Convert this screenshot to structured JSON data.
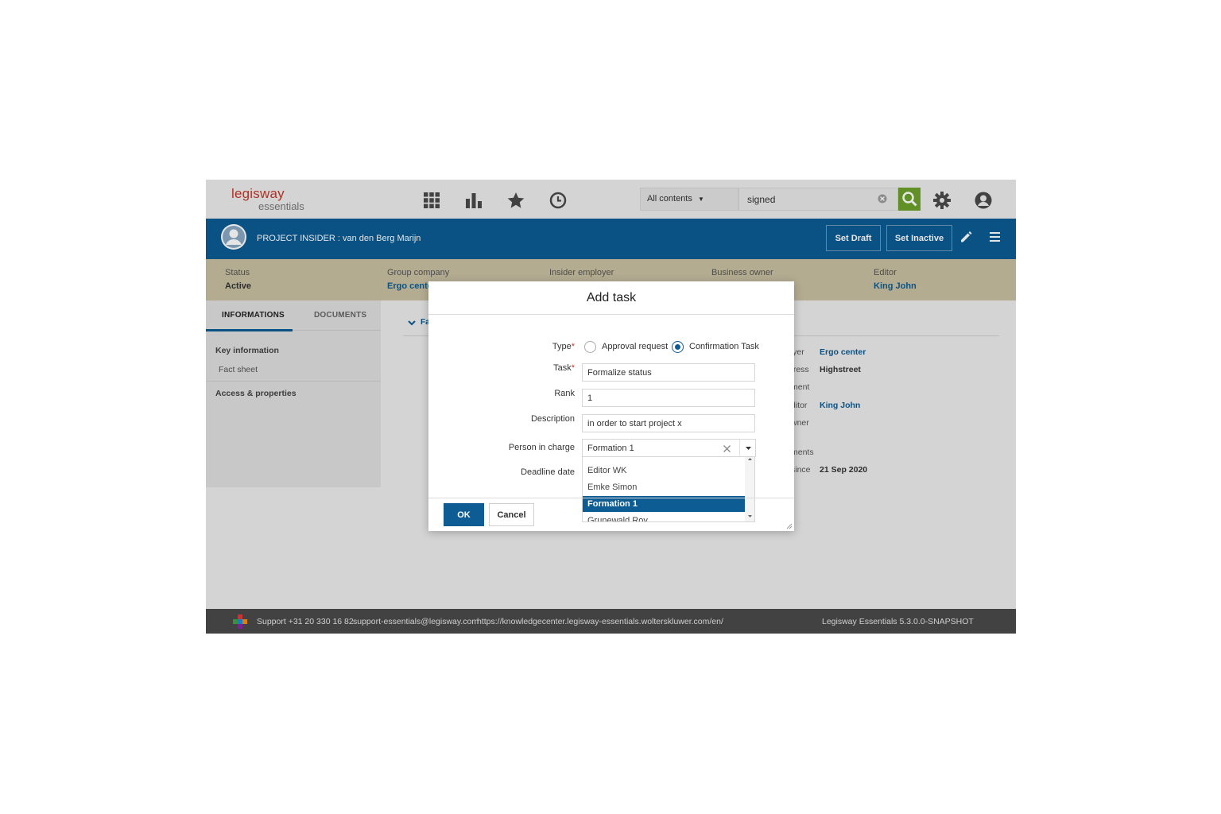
{
  "app": {
    "logo_top": "legisway",
    "logo_bottom": "essentials"
  },
  "search": {
    "scope": "All contents",
    "value": "signed"
  },
  "header": {
    "title": "PROJECT INSIDER : van den Berg Marijn",
    "set_draft": "Set Draft",
    "set_inactive": "Set Inactive"
  },
  "status": [
    {
      "label": "Status",
      "value": "Active"
    },
    {
      "label": "Group company",
      "value": "Ergo center"
    },
    {
      "label": "Insider employer",
      "value": ""
    },
    {
      "label": "Business owner",
      "value": ""
    },
    {
      "label": "Editor",
      "value": "King John"
    }
  ],
  "tabs": [
    "INFORMATIONS",
    "DOCUMENTS"
  ],
  "leftnav": {
    "key_information": "Key information",
    "fact_sheet": "Fact sheet",
    "access_properties": "Access & properties"
  },
  "content": {
    "section": "Fa",
    "rows": [
      {
        "label": "loyer",
        "value": "Ergo center"
      },
      {
        "label": "dress",
        "value": "Highstreet"
      },
      {
        "label": "ment",
        "value": ""
      },
      {
        "label": "ditor",
        "value": "King John"
      },
      {
        "label": "wner",
        "value": ""
      },
      {
        "label": "ments",
        "value": ""
      },
      {
        "label": "since",
        "value": "21 Sep 2020"
      }
    ]
  },
  "footer": {
    "support": "Support +31 20 330 16 82",
    "email": "support-essentials@legisway.com",
    "url": "https://knowledgecenter.legisway-essentials.wolterskluwer.com/en/",
    "version": "Legisway Essentials  5.3.0.0-SNAPSHOT"
  },
  "dialog": {
    "title": "Add task",
    "type_label": "Type",
    "type_options": [
      "Approval request",
      "Confirmation Task"
    ],
    "type_selected": "Confirmation Task",
    "task_label": "Task",
    "task_value": "Formalize status",
    "rank_label": "Rank",
    "rank_value": "1",
    "description_label": "Description",
    "description_value": "in order to start project x",
    "person_label": "Person in charge",
    "person_value": "Formation 1",
    "deadline_label": "Deadline date",
    "person_options": [
      "Editor WK",
      "Emke Simon",
      "Formation 1",
      "Grunewald Roy"
    ],
    "person_selected": "Formation 1",
    "ok": "OK",
    "cancel": "Cancel"
  }
}
